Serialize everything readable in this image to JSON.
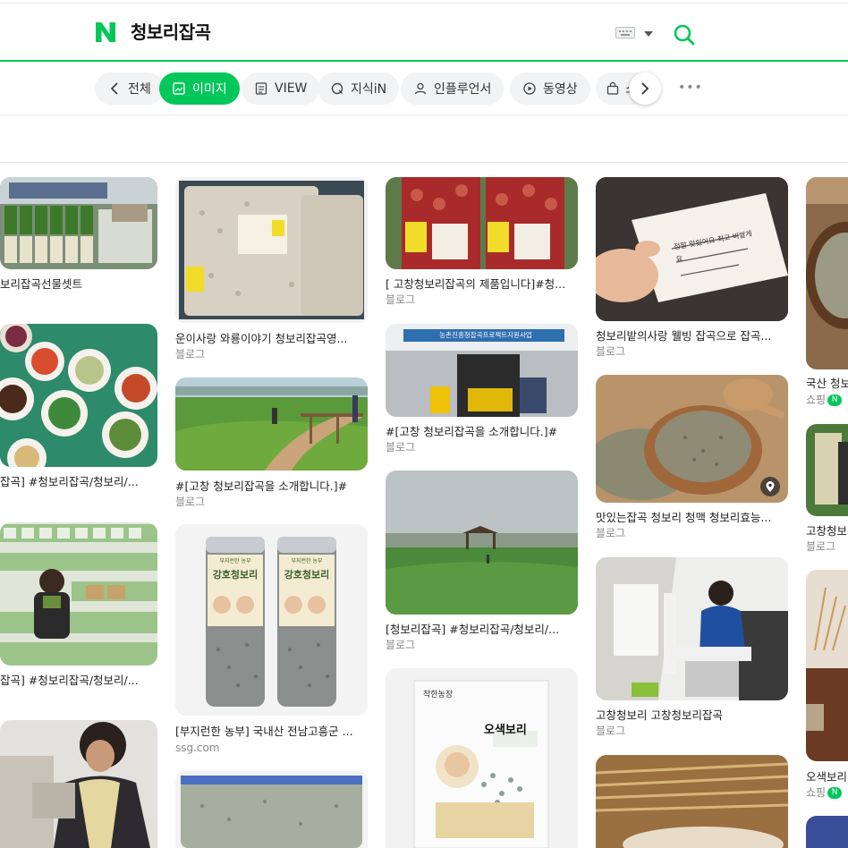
{
  "search": {
    "query": "청보리잡곡"
  },
  "colors": {
    "brand": "#03c75a"
  },
  "tabs": [
    {
      "label": "전체",
      "icon": "chevron-left-icon"
    },
    {
      "label": "이미지",
      "icon": "image-icon"
    },
    {
      "label": "VIEW",
      "icon": "document-icon"
    },
    {
      "label": "지식iN",
      "icon": "q-icon"
    },
    {
      "label": "인플루언서",
      "icon": "person-icon"
    },
    {
      "label": "동영상",
      "icon": "play-icon"
    },
    {
      "label": "쇼",
      "icon": "bag-icon"
    }
  ],
  "more_label": "•••",
  "results": {
    "col1": [
      {
        "title": "보리잡곡선물셋트",
        "source": ""
      },
      {
        "title": "잡곡] #청보리잡곡/청보리/...",
        "source": ""
      },
      {
        "title": "잡곡] #청보리잡곡/청보리/...",
        "source": ""
      },
      {
        "title": "",
        "source": ""
      }
    ],
    "col2": [
      {
        "title": "운이사랑 와룡이야기 청보리잡곡영...",
        "source": "블로그"
      },
      {
        "title": "#[고창 청보리잡곡을 소개합니다.]#",
        "source": "블로그"
      },
      {
        "title": "[부지런한 농부] 국내산 전남고흥군 ...",
        "source": "ssg.com"
      },
      {
        "title": "",
        "source": ""
      }
    ],
    "col3": [
      {
        "title": "[ 고창청보리잡곡의 제품입니다]#청...",
        "source": "블로그"
      },
      {
        "title": "#[고창 청보리잡곡을 소개합니다.]#",
        "source": "블로그"
      },
      {
        "title": "[청보리잡곡] #청보리잡곡/청보리/...",
        "source": "블로그"
      },
      {
        "title": "",
        "source": ""
      }
    ],
    "col4": [
      {
        "title": "청보리밭의사랑 웰빙 잡곡으로 잡곡...",
        "source": "블로그"
      },
      {
        "title": "맛있는잡곡 청보리 청맥 청보리효능...",
        "source": "블로그"
      },
      {
        "title": "고창청보리 고창청보리잡곡",
        "source": "블로그"
      },
      {
        "title": "",
        "source": ""
      }
    ],
    "col5": [
      {
        "title": "국산 청보",
        "source": "쇼핑"
      },
      {
        "title": "고창청보",
        "source": "블로그"
      },
      {
        "title": "오색보리",
        "source": "쇼핑"
      }
    ]
  },
  "image_texts": {
    "barley_brand": "강호청보리",
    "barley_top": "부지런한 농부",
    "package_brand": "오색보리",
    "package_top": "착한농장",
    "building_sign": "농촌진흥청잡곡프로젝트지원사업",
    "note": "정말 맛있어요 최고 비쌀게요"
  },
  "npay": "N"
}
